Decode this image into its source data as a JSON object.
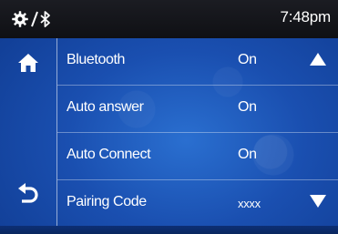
{
  "status_bar": {
    "time": "7:48pm",
    "icons": [
      "settings-gear-icon",
      "bluetooth-icon"
    ]
  },
  "sidebar": {
    "icons": [
      "home-icon",
      "back-icon"
    ]
  },
  "settings": {
    "rows": [
      {
        "label": "Bluetooth",
        "value": "On"
      },
      {
        "label": "Auto answer",
        "value": "On"
      },
      {
        "label": "Auto Connect",
        "value": "On"
      },
      {
        "label": "Pairing Code",
        "value": "xxxx"
      }
    ]
  },
  "scroll": {
    "icons": [
      "scroll-up-icon",
      "scroll-down-icon"
    ]
  },
  "colors": {
    "top_bar": "#15161b",
    "background": "#1a4fb0",
    "text": "#ffffff"
  }
}
